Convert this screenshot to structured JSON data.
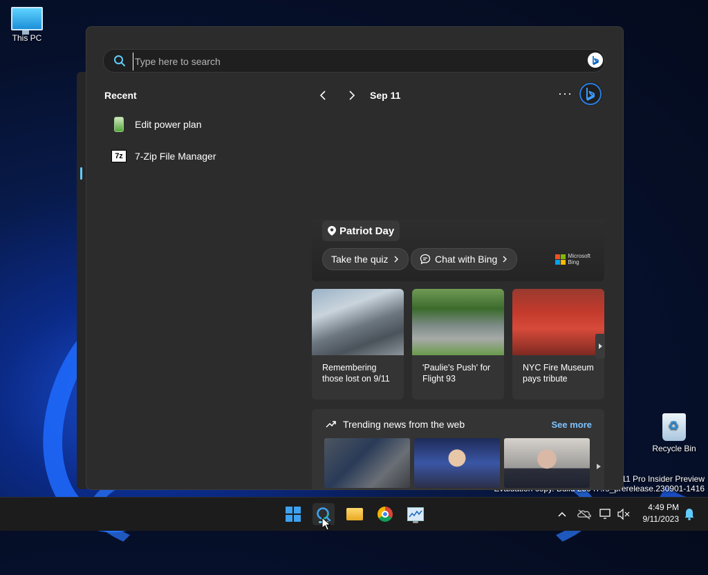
{
  "desktop": {
    "icons": [
      {
        "label": "This PC"
      },
      {
        "label": "Recycle Bin"
      }
    ],
    "watermark_line1": "s 11 Pro Insider Preview",
    "watermark_line2": "Evaluation copy. Build 25947.rs_prerelease.230901-1416"
  },
  "search_panel": {
    "search": {
      "placeholder": "Type here to search",
      "value": ""
    },
    "recent": {
      "title": "Recent",
      "items": [
        {
          "label": "Edit power plan",
          "icon": "battery-icon"
        },
        {
          "label": "7-Zip File Manager",
          "icon": "7zip-icon"
        }
      ]
    },
    "highlights": {
      "date": "Sep 11",
      "more_label": "···",
      "hero": {
        "title": "Patriot Day",
        "quiz_label": "Take the quiz",
        "chat_label": "Chat with Bing",
        "brand_line1": "Microsoft",
        "brand_line2": "Bing"
      },
      "cards": [
        {
          "caption": "Remembering those lost on 9/11"
        },
        {
          "caption": "'Paulie's Push' for Flight 93"
        },
        {
          "caption": "NYC Fire Museum pays tribute"
        }
      ],
      "trending": {
        "title": "Trending news from the web",
        "see_more": "See more"
      }
    }
  },
  "taskbar": {
    "apps": [
      "start",
      "search",
      "file-explorer",
      "chrome",
      "resource-monitor"
    ],
    "clock": {
      "time": "4:49 PM",
      "date": "9/11/2023"
    }
  },
  "colors": {
    "accent": "#60cdff",
    "link": "#7ec3ff",
    "panel": "#2c2c2c"
  }
}
